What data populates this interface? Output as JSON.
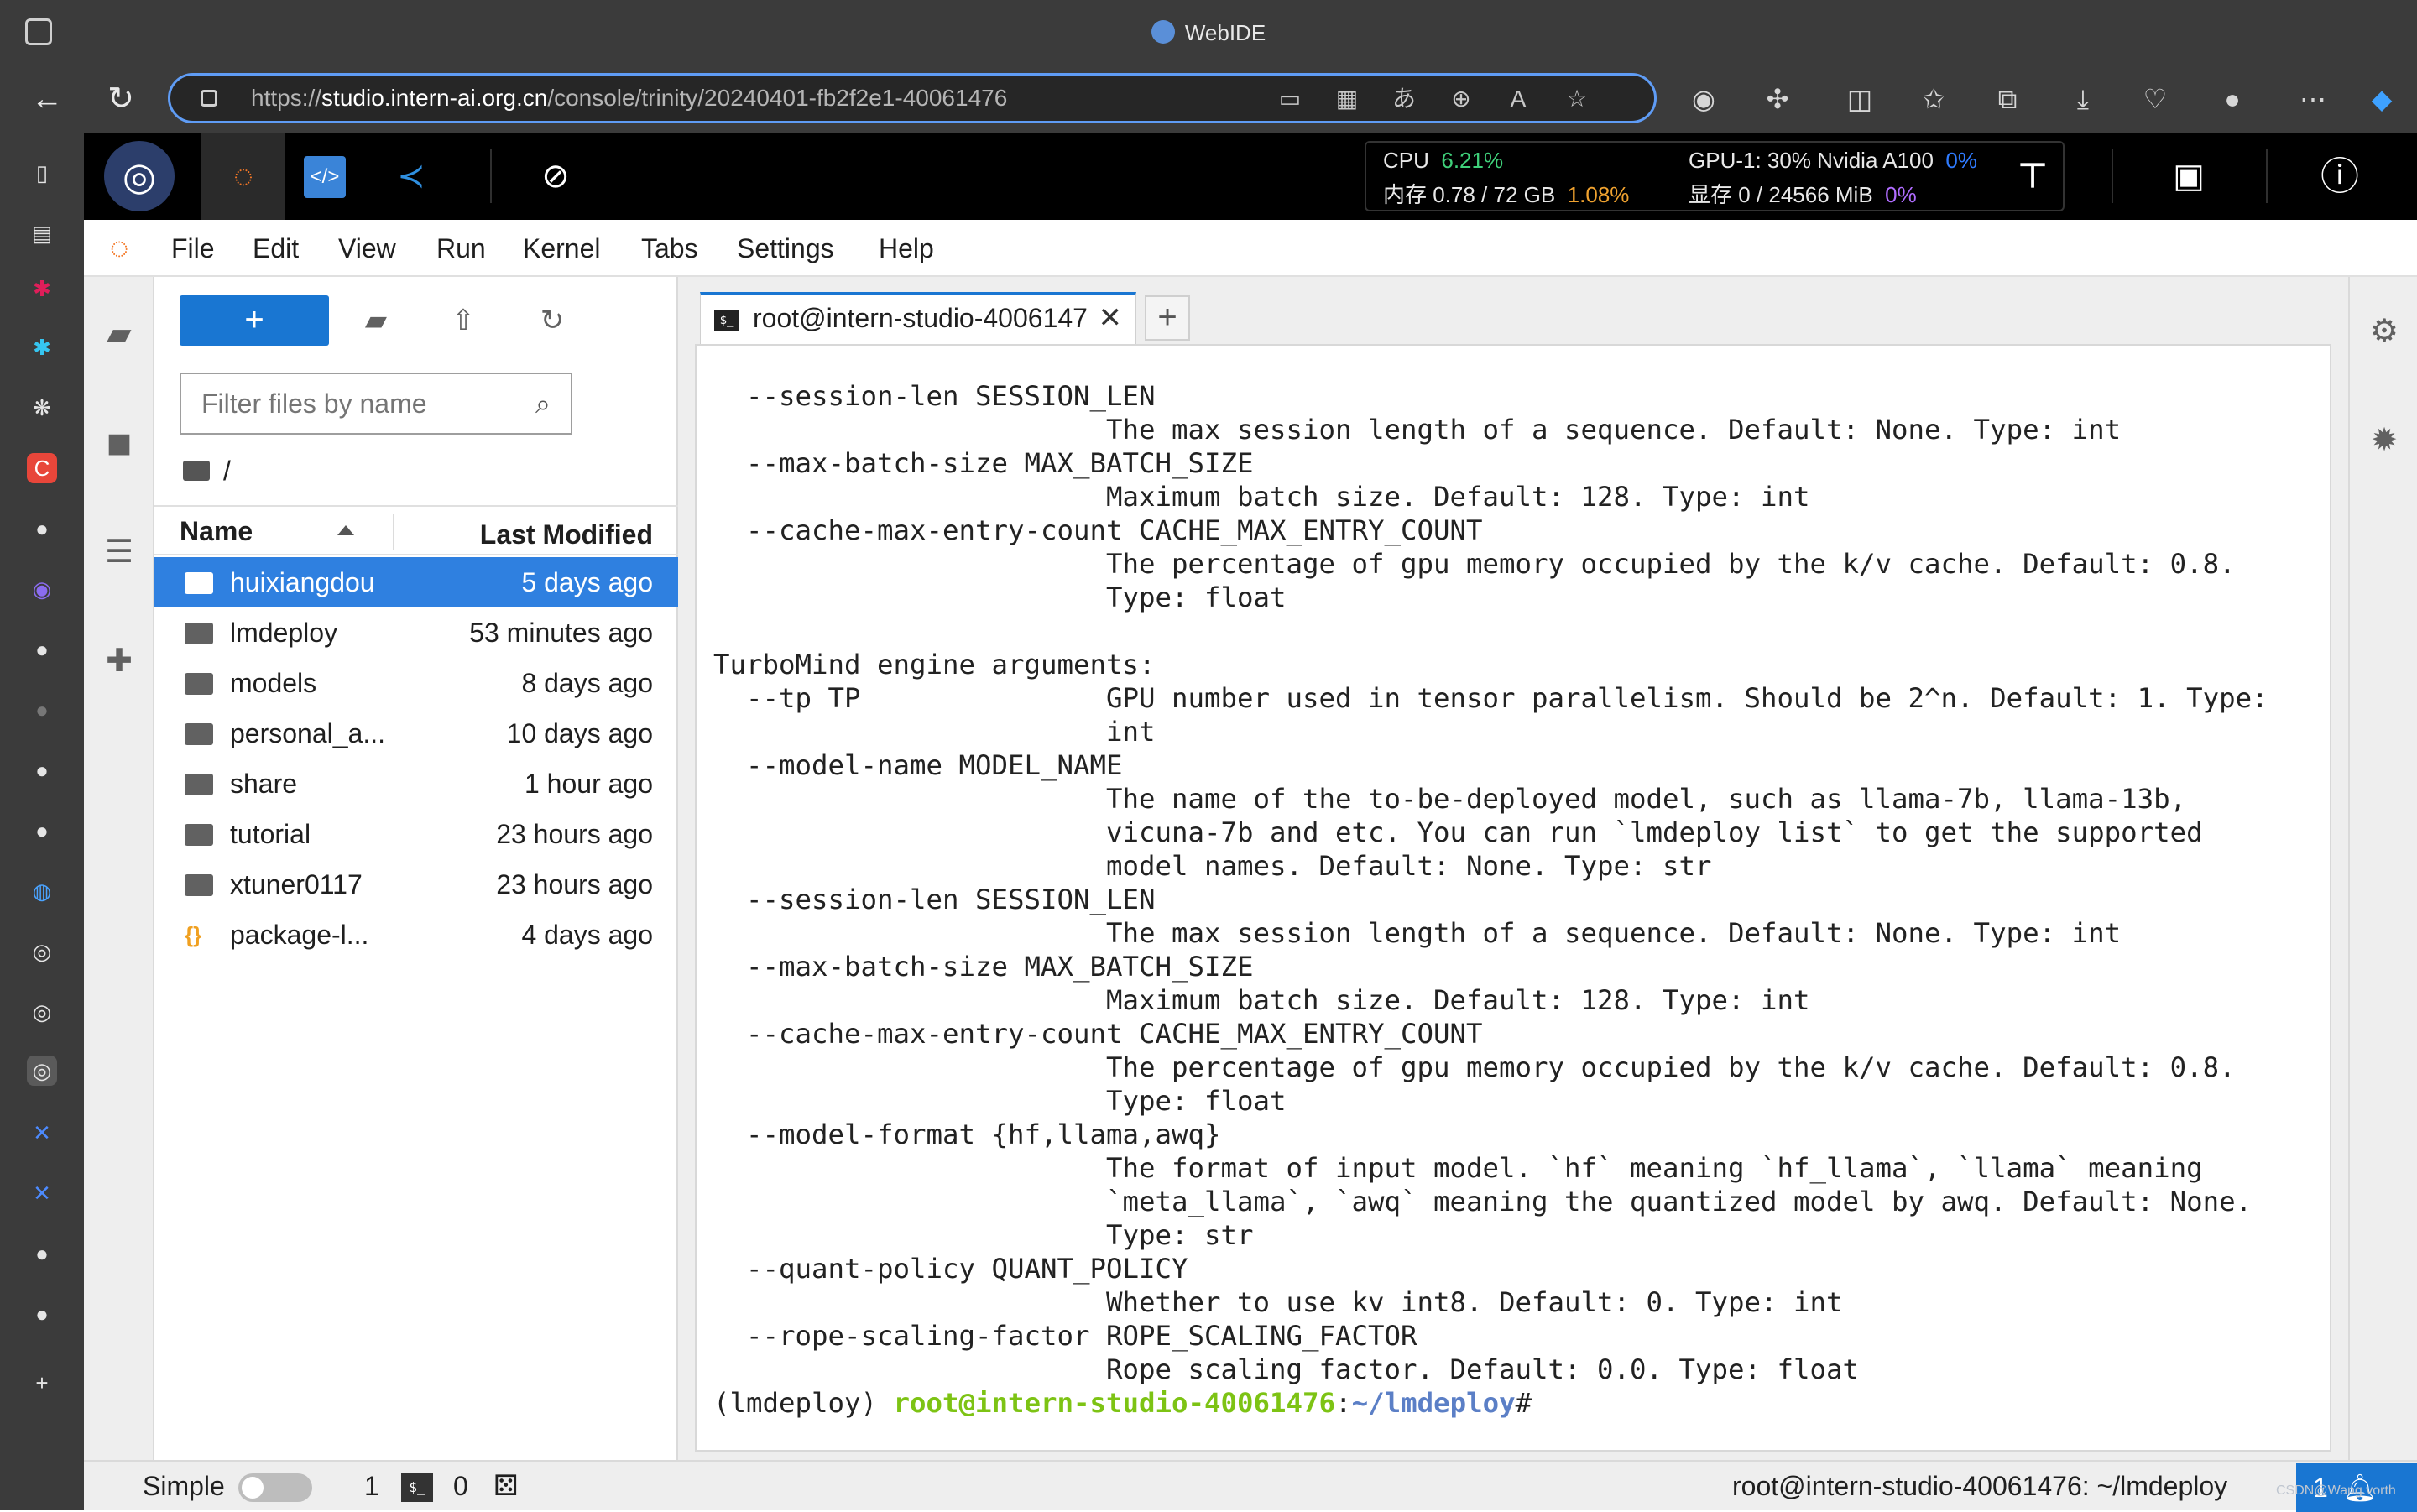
{
  "browser": {
    "window_title": "WebIDE",
    "url_prefix": "https://",
    "url_host": "studio.intern-ai.org.cn",
    "url_path": "/console/trinity/20240401-fb2f2e1-40061476"
  },
  "monitor": {
    "cpu_label": "CPU",
    "cpu_value": "6.21%",
    "mem_label": "内存 0.78 / 72 GB",
    "mem_value": "1.08%",
    "gpu_label": "GPU-1: 30% Nvidia A100",
    "gpu_value": "0%",
    "vram_label": "显存 0 / 24566 MiB",
    "vram_value": "0%"
  },
  "menu": [
    "File",
    "Edit",
    "View",
    "Run",
    "Kernel",
    "Tabs",
    "Settings",
    "Help"
  ],
  "filebrowser": {
    "filter_placeholder": "Filter files by name",
    "breadcrumb": "/",
    "col_name": "Name",
    "col_modified": "Last Modified",
    "files": [
      {
        "name": "huixiangdou",
        "modified": "5 days ago",
        "type": "folder",
        "selected": true
      },
      {
        "name": "lmdeploy",
        "modified": "53 minutes ago",
        "type": "folder"
      },
      {
        "name": "models",
        "modified": "8 days ago",
        "type": "folder"
      },
      {
        "name": "personal_a...",
        "modified": "10 days ago",
        "type": "folder"
      },
      {
        "name": "share",
        "modified": "1 hour ago",
        "type": "folder"
      },
      {
        "name": "tutorial",
        "modified": "23 hours ago",
        "type": "folder"
      },
      {
        "name": "xtuner0117",
        "modified": "23 hours ago",
        "type": "folder"
      },
      {
        "name": "package-l...",
        "modified": "4 days ago",
        "type": "json"
      }
    ]
  },
  "tab": {
    "label": "root@intern-studio-40061476",
    "close": "✕",
    "add": "+"
  },
  "terminal": {
    "lines": [
      "  --session-len SESSION_LEN",
      "                        The max session length of a sequence. Default: None. Type: int",
      "  --max-batch-size MAX_BATCH_SIZE",
      "                        Maximum batch size. Default: 128. Type: int",
      "  --cache-max-entry-count CACHE_MAX_ENTRY_COUNT",
      "                        The percentage of gpu memory occupied by the k/v cache. Default: 0.8.",
      "                        Type: float",
      "",
      "TurboMind engine arguments:",
      "  --tp TP               GPU number used in tensor parallelism. Should be 2^n. Default: 1. Type:",
      "                        int",
      "  --model-name MODEL_NAME",
      "                        The name of the to-be-deployed model, such as llama-7b, llama-13b,",
      "                        vicuna-7b and etc. You can run `lmdeploy list` to get the supported",
      "                        model names. Default: None. Type: str",
      "  --session-len SESSION_LEN",
      "                        The max session length of a sequence. Default: None. Type: int",
      "  --max-batch-size MAX_BATCH_SIZE",
      "                        Maximum batch size. Default: 128. Type: int",
      "  --cache-max-entry-count CACHE_MAX_ENTRY_COUNT",
      "                        The percentage of gpu memory occupied by the k/v cache. Default: 0.8.",
      "                        Type: float",
      "  --model-format {hf,llama,awq}",
      "                        The format of input model. `hf` meaning `hf_llama`, `llama` meaning",
      "                        `meta_llama`, `awq` meaning the quantized model by awq. Default: None.",
      "                        Type: str",
      "  --quant-policy QUANT_POLICY",
      "                        Whether to use kv int8. Default: 0. Type: int",
      "  --rope-scaling-factor ROPE_SCALING_FACTOR",
      "                        Rope scaling factor. Default: 0.0. Type: float"
    ],
    "prompt_env": "(lmdeploy) ",
    "prompt_user": "root@intern-studio-40061476",
    "prompt_colon": ":",
    "prompt_path": "~/lmdeploy",
    "prompt_hash": "#"
  },
  "status": {
    "mode_label": "Simple",
    "count_a": "1",
    "count_b": "0",
    "right_text": "root@intern-studio-40061476: ~/lmdeploy",
    "notifications": "1",
    "watermark": "CSDN@Wang.vorth"
  },
  "colors": {
    "accent": "#1976d2",
    "prompt_green": "#7dc314",
    "prompt_blue": "#5b7fc6"
  }
}
